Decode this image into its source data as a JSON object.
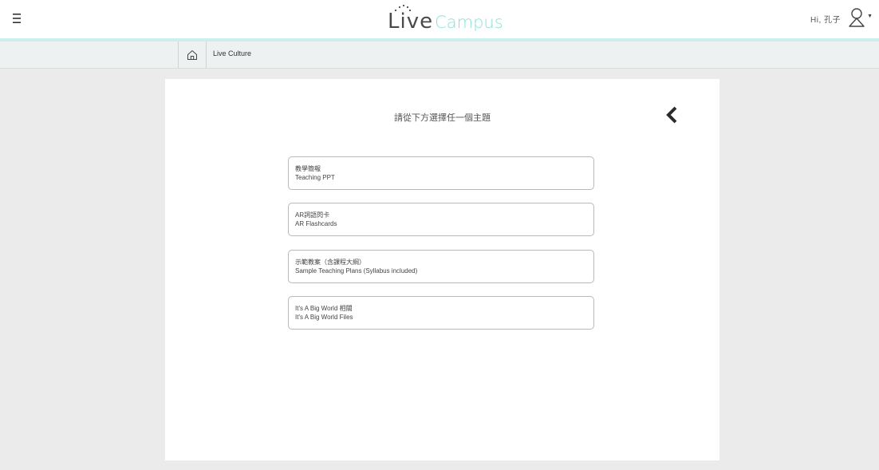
{
  "header": {
    "logo_live": "Live",
    "logo_campus": "Campus",
    "greeting": "Hi, 孔子"
  },
  "breadcrumb": {
    "item": "Live Culture"
  },
  "main": {
    "prompt": "請從下方選擇任一個主題",
    "options": [
      {
        "zh": "教學簡報",
        "en": "Teaching PPT"
      },
      {
        "zh": "AR詞語閃卡",
        "en": "AR Flashcards"
      },
      {
        "zh": "示範教案（含課程大綱）",
        "en": "Sample Teaching Plans (Syllabus included)"
      },
      {
        "zh": "It's A Big World 相關",
        "en": "It's A Big World Files"
      }
    ]
  },
  "icons": {
    "menu": "hamburger-icon",
    "user": "user-icon",
    "home": "home-icon",
    "back": "chevron-left-icon"
  },
  "colors": {
    "accent": "#c9f0ea",
    "logo_campus": "#8fe0d6",
    "content_bg": "#ebebeb"
  }
}
